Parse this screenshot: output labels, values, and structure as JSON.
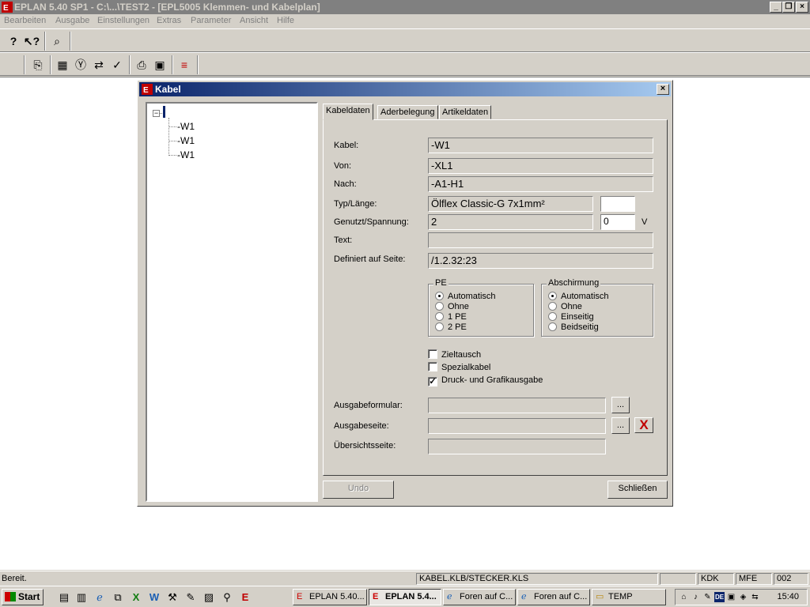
{
  "window": {
    "title": "EPLAN 5.40 SP1 - C:\\...\\TEST2 - [EPL5005 Klemmen- und Kabelplan]",
    "minimize": "_",
    "restore": "❐",
    "close": "×"
  },
  "menu": [
    "Bearbeiten",
    "Ausgabe",
    "Einstellungen",
    "Extras",
    "Parameter",
    "Ansicht",
    "Hilfe"
  ],
  "dialog": {
    "title": "Kabel",
    "close": "×",
    "tree": {
      "expander": "−",
      "items": [
        "-W1",
        "-W1",
        "-W1"
      ]
    },
    "tabs": [
      "Kabeldaten",
      "Aderbelegung",
      "Artikeldaten"
    ],
    "fields": {
      "kabel_label": "Kabel:",
      "kabel_value": "-W1",
      "von_label": "Von:",
      "von_value": "-XL1",
      "nach_label": "Nach:",
      "nach_value": "-A1-H1",
      "typ_label": "Typ/Länge:",
      "typ_value": "Ölflex Classic-G 7x1mm²",
      "laenge_value": "",
      "genutzt_label": "Genutzt/Spannung:",
      "genutzt_value": "2",
      "spannung_value": "0",
      "spannung_unit": "V",
      "text_label": "Text:",
      "text_value": "",
      "definiert_label": "Definiert auf Seite:",
      "definiert_value": "/1.2.32:23"
    },
    "pe_group": {
      "title": "PE",
      "options": [
        "Automatisch",
        "Ohne",
        "1 PE",
        "2 PE"
      ],
      "selected": 0
    },
    "abschirmung_group": {
      "title": "Abschirmung",
      "options": [
        "Automatisch",
        "Ohne",
        "Einseitig",
        "Beidseitig"
      ],
      "selected": 0
    },
    "checkboxes": {
      "zieltausch": "Zieltausch",
      "spezialkabel": "Spezialkabel",
      "druck": "Druck- und Grafikausgabe",
      "druck_mark": "✓"
    },
    "output": {
      "formular_label": "Ausgabeformular:",
      "formular_value": "",
      "seite_label": "Ausgabeseite:",
      "seite_value": "",
      "uebersicht_label": "Übersichtsseite:",
      "uebersicht_value": "",
      "browse": "...",
      "delete_mark": "X"
    },
    "buttons": {
      "undo": "Undo",
      "close": "Schließen"
    }
  },
  "status": {
    "text": "Bereit.",
    "file": "KABEL.KLB/STECKER.KLS",
    "empty": "",
    "kdk": "KDK",
    "mfe": "MFE",
    "num": "002"
  },
  "taskbar": {
    "start": "Start",
    "tasks": [
      "EPLAN 5.40...",
      "EPLAN 5.4...",
      "Foren auf C...",
      "Foren auf C...",
      "TEMP"
    ],
    "clock": "15:40",
    "lang": "DE"
  }
}
